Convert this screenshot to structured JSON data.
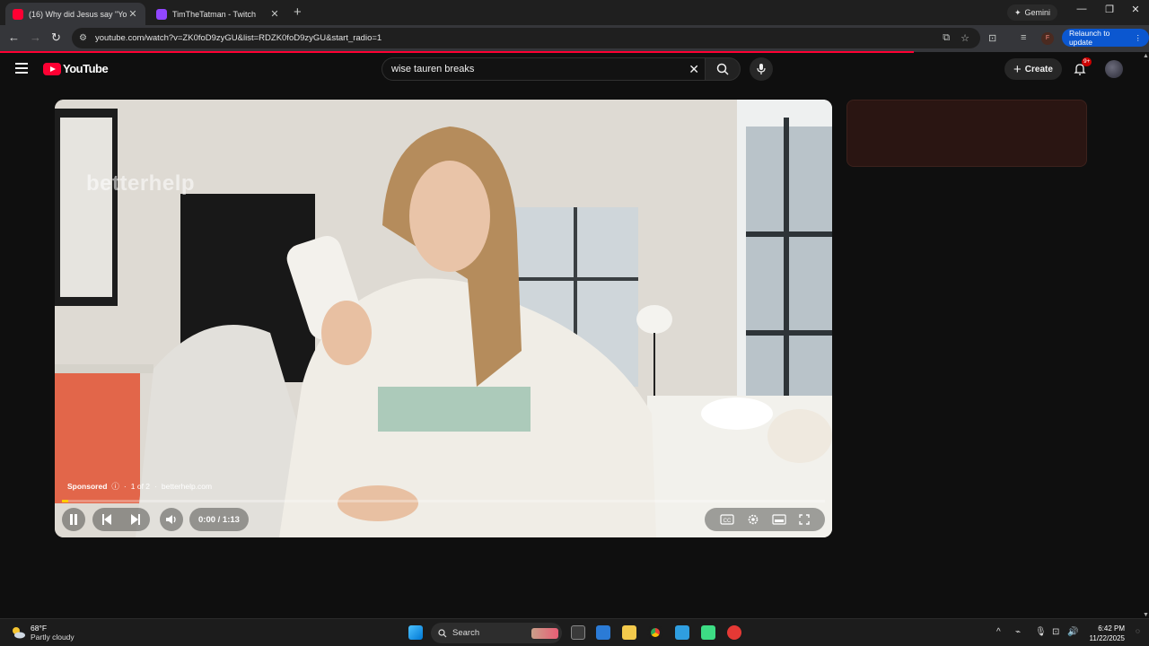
{
  "browser": {
    "tabs": [
      {
        "title": "(16) Why did Jesus say \"Yo",
        "active": true
      },
      {
        "title": "TimTheTatman - Twitch",
        "active": false
      }
    ],
    "gemini_label": "Gemini",
    "url": "youtube.com/watch?v=ZK0foD9zyGU&list=RDZK0foD9zyGU&start_radio=1",
    "profile_initial": "F",
    "relaunch_label": "Relaunch to update"
  },
  "youtube": {
    "logo_text": "YouTube",
    "search_query": "wise tauren breaks",
    "create_label": "Create",
    "notification_badge": "9+"
  },
  "player": {
    "watermark": "betterhelp",
    "sponsored_label": "Sponsored",
    "ad_position": "1 of 2",
    "ad_domain": "betterhelp.com",
    "time_display": "0:00 / 1:13",
    "progress_fraction": 0.008
  },
  "taskbar": {
    "weather_temp": "68°F",
    "weather_desc": "Partly cloudy",
    "search_label": "Search",
    "time": "6:42 PM",
    "date": "11/22/2025"
  },
  "colors": {
    "accent_red": "#ff0033",
    "progress_yellow": "#ffcc00",
    "relaunch_blue": "#0b57d0"
  }
}
